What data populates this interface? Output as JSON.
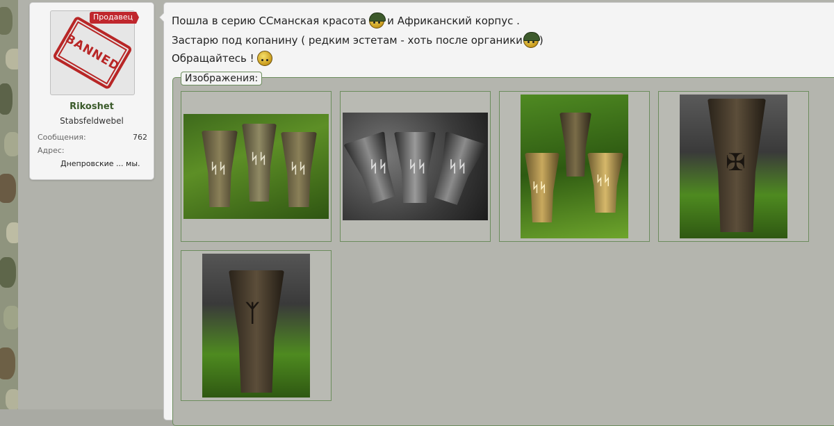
{
  "user": {
    "badge": "Продавец",
    "avatar_stamp": "BANNED",
    "username": "Rikoshet",
    "rank": "Stabsfeldwebel",
    "messages_label": "Сообщения:",
    "messages_value": "762",
    "address_label": "Адрес:",
    "address_value": "Днепровские ... мы."
  },
  "post": {
    "line1_a": "Пошла в серию ССманская красота",
    "line1_b": "и Африканский корпус .",
    "line2": "Застарю под копанину ( редким эстетам - хоть после органики",
    "line2_end": ")",
    "line3": "Обращайтесь !",
    "attachments_legend": "Изображения:"
  },
  "icons": {
    "smiley_helmet": "soldier-helmet-smiley-icon",
    "smiley": "smiley-icon"
  },
  "colors": {
    "username": "#3a5a2a",
    "badge": "#c0272d",
    "fieldset_border": "#6b8c5c"
  }
}
